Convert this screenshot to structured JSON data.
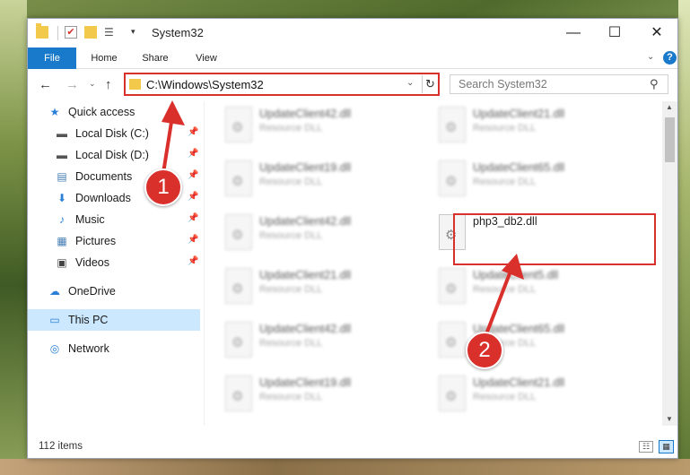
{
  "window": {
    "title": "System32",
    "controls": {
      "minimize": "—",
      "maximize": "☐",
      "close": "✕"
    },
    "quick_access_toolbar": {
      "check_icon": "✔",
      "properties_icon": "☰",
      "dropdown_icon": "▾"
    }
  },
  "ribbon": {
    "tabs": [
      "File",
      "Home",
      "Share",
      "View"
    ],
    "collapse_icon": "⌄",
    "help_icon": "?"
  },
  "navigation": {
    "back_icon": "←",
    "forward_icon": "→",
    "recent_icon": "⌄",
    "up_icon": "↑",
    "address": "C:\\Windows\\System32",
    "address_dropdown_icon": "⌄",
    "refresh_icon": "↻",
    "search_placeholder": "Search System32",
    "search_icon": "⚲"
  },
  "sidebar": {
    "pin_icon": "📌",
    "items": [
      {
        "label": "Quick access",
        "icon": "★",
        "icon_color": "#2a7fd6",
        "pinned": false
      },
      {
        "label": "Local Disk (C:)",
        "icon": "▬",
        "icon_color": "#555555",
        "pinned": true
      },
      {
        "label": "Local Disk (D:)",
        "icon": "▬",
        "icon_color": "#555555",
        "pinned": true
      },
      {
        "label": "Documents",
        "icon": "▤",
        "icon_color": "#4a7fb5",
        "pinned": true
      },
      {
        "label": "Downloads",
        "icon": "⬇",
        "icon_color": "#2a7fd6",
        "pinned": true
      },
      {
        "label": "Music",
        "icon": "♪",
        "icon_color": "#2a7fd6",
        "pinned": true
      },
      {
        "label": "Pictures",
        "icon": "▦",
        "icon_color": "#4a7fb5",
        "pinned": true
      },
      {
        "label": "Videos",
        "icon": "▣",
        "icon_color": "#444444",
        "pinned": true
      },
      {
        "label": "OneDrive",
        "icon": "☁",
        "icon_color": "#2a7fd6",
        "pinned": false
      },
      {
        "label": "This PC",
        "icon": "▭",
        "icon_color": "#2a7fd6",
        "pinned": false,
        "selected": true
      },
      {
        "label": "Network",
        "icon": "◎",
        "icon_color": "#2a7fd6",
        "pinned": false
      }
    ]
  },
  "files": {
    "left_column": [
      {
        "name": "UpdateClient42.dll",
        "type": "Resource DLL"
      },
      {
        "name": "UpdateClient19.dll",
        "type": "Resource DLL"
      },
      {
        "name": "UpdateClient42.dll",
        "type": "Resource DLL"
      },
      {
        "name": "UpdateClient21.dll",
        "type": "Resource DLL"
      },
      {
        "name": "UpdateClient42.dll",
        "type": "Resource DLL"
      },
      {
        "name": "UpdateClient19.dll",
        "type": "Resource DLL"
      }
    ],
    "right_column": [
      {
        "name": "UpdateClient21.dll",
        "type": "Resource DLL"
      },
      {
        "name": "UpdateClient65.dll",
        "type": "Resource DLL"
      },
      {
        "name": "php3_db2.dll",
        "type": "",
        "highlighted": true
      },
      {
        "name": "UpdateClient5.dll",
        "type": "Resource DLL"
      },
      {
        "name": "UpdateClient65.dll",
        "type": "Resource DLL"
      },
      {
        "name": "UpdateClient21.dll",
        "type": "Resource DLL"
      }
    ]
  },
  "status": {
    "item_count": "112 items"
  },
  "scrollbar": {
    "up_icon": "▲",
    "down_icon": "▼"
  },
  "view_toggle": {
    "details_icon": "☷",
    "large_icons_icon": "▦"
  },
  "annotations": {
    "marker_1": "1",
    "marker_2": "2",
    "color": "#d9302c"
  }
}
